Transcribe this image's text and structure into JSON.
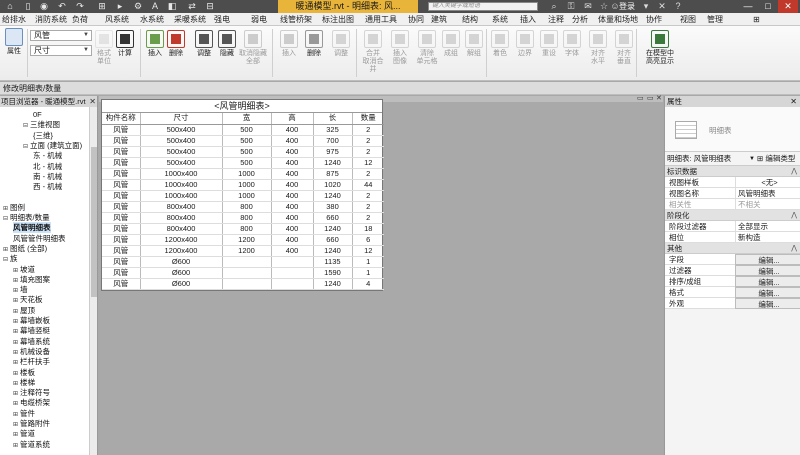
{
  "title": {
    "text": "暖通模型.rvt - 明细表: 风...",
    "search_placeholder": "键入关键字或短语",
    "login": "登录",
    "window_buttons": [
      "—",
      "□",
      "✕"
    ]
  },
  "quick_access": [
    "⌂",
    "▯",
    "◉",
    "↶",
    "↷",
    "⊞",
    "▸",
    "⚙",
    "A",
    "◧",
    "⇄",
    "⊟"
  ],
  "menu": [
    "给排水",
    "消防系统",
    "负荷",
    "风系统",
    "水系统",
    "采暖系统",
    "强电",
    "弱电",
    "线管桥架",
    "标注出图",
    "通用工具",
    "协同",
    "建筑",
    "结构",
    "系统",
    "插入",
    "注释",
    "分析",
    "体量和场地",
    "协作",
    "视图",
    "管理",
    "⊞"
  ],
  "ribbon": {
    "properties_label": "属性",
    "combo_parameter": "风管",
    "combo_unit": "尺寸",
    "buttons": [
      {
        "label": "格式\n单位",
        "icon": "format-units-icon"
      },
      {
        "label": "计算",
        "icon": "calculate-icon"
      },
      {
        "label": "插入",
        "icon": "insert-icon"
      },
      {
        "label": "删除",
        "icon": "delete-icon"
      },
      {
        "label": "调整",
        "icon": "resize-icon"
      },
      {
        "label": "隐藏",
        "icon": "hide-icon"
      },
      {
        "label": "取消隐藏\n全部",
        "icon": "unhide-all-icon"
      },
      {
        "label": "插入",
        "icon": "insert-row-icon"
      },
      {
        "label": "删除",
        "icon": "delete-row-icon"
      },
      {
        "label": "调整",
        "icon": "resize-row-icon"
      },
      {
        "label": "合并\n取消合并",
        "icon": "merge-icon"
      },
      {
        "label": "插入\n图像",
        "icon": "insert-image-icon"
      },
      {
        "label": "清除\n单元格",
        "icon": "clear-cell-icon"
      },
      {
        "label": "成组",
        "icon": "group-icon"
      },
      {
        "label": "解组",
        "icon": "ungroup-icon"
      },
      {
        "label": "着色",
        "icon": "shading-icon"
      },
      {
        "label": "边界",
        "icon": "borders-icon"
      },
      {
        "label": "重设",
        "icon": "reset-icon"
      },
      {
        "label": "字体",
        "icon": "font-icon"
      },
      {
        "label": "对齐\n水平",
        "icon": "align-horizontal-icon"
      },
      {
        "label": "对齐\n垂直",
        "icon": "align-vertical-icon"
      },
      {
        "label": "在模型中\n高亮显示",
        "icon": "highlight-in-model-icon"
      }
    ]
  },
  "context_bar": "修改明细表/数量",
  "browser": {
    "header": "项目浏览器 - 暖通模型.rvt",
    "close": "✕",
    "items": [
      {
        "label": "0F",
        "indent": 3,
        "toggle": ""
      },
      {
        "label": "三维视图",
        "indent": 2,
        "toggle": "⊟"
      },
      {
        "label": "{三维}",
        "indent": 3,
        "toggle": ""
      },
      {
        "label": "立面 (建筑立面)",
        "indent": 2,
        "toggle": "⊟"
      },
      {
        "label": "东 - 机械",
        "indent": 3,
        "toggle": ""
      },
      {
        "label": "北 - 机械",
        "indent": 3,
        "toggle": ""
      },
      {
        "label": "南 - 机械",
        "indent": 3,
        "toggle": ""
      },
      {
        "label": "西 - 机械",
        "indent": 3,
        "toggle": ""
      },
      {
        "label": "",
        "indent": 0,
        "toggle": ""
      },
      {
        "label": "图例",
        "indent": 0,
        "toggle": "⊞"
      },
      {
        "label": "明细表/数量",
        "indent": 0,
        "toggle": "⊟"
      },
      {
        "label": "风管明细表",
        "indent": 1,
        "toggle": "",
        "selected": true
      },
      {
        "label": "风管管件明细表",
        "indent": 1,
        "toggle": ""
      },
      {
        "label": "图纸 (全部)",
        "indent": 0,
        "toggle": "⊞"
      },
      {
        "label": "族",
        "indent": 0,
        "toggle": "⊟"
      },
      {
        "label": "坡道",
        "indent": 1,
        "toggle": "⊞"
      },
      {
        "label": "填充图案",
        "indent": 1,
        "toggle": "⊞"
      },
      {
        "label": "墙",
        "indent": 1,
        "toggle": "⊞"
      },
      {
        "label": "天花板",
        "indent": 1,
        "toggle": "⊞"
      },
      {
        "label": "屋顶",
        "indent": 1,
        "toggle": "⊞"
      },
      {
        "label": "幕墙嵌板",
        "indent": 1,
        "toggle": "⊞"
      },
      {
        "label": "幕墙竖梃",
        "indent": 1,
        "toggle": "⊞"
      },
      {
        "label": "幕墙系统",
        "indent": 1,
        "toggle": "⊞"
      },
      {
        "label": "机械设备",
        "indent": 1,
        "toggle": "⊞"
      },
      {
        "label": "栏杆扶手",
        "indent": 1,
        "toggle": "⊞"
      },
      {
        "label": "楼板",
        "indent": 1,
        "toggle": "⊞"
      },
      {
        "label": "楼梯",
        "indent": 1,
        "toggle": "⊞"
      },
      {
        "label": "注释符号",
        "indent": 1,
        "toggle": "⊞"
      },
      {
        "label": "电缆桥架",
        "indent": 1,
        "toggle": "⊞"
      },
      {
        "label": "管件",
        "indent": 1,
        "toggle": "⊞"
      },
      {
        "label": "管路附件",
        "indent": 1,
        "toggle": "⊞"
      },
      {
        "label": "管道",
        "indent": 1,
        "toggle": "⊞"
      },
      {
        "label": "管道系统",
        "indent": 1,
        "toggle": "⊞"
      }
    ]
  },
  "schedule": {
    "title": "<风管明细表>",
    "columns": [
      "构件名称",
      "尺寸",
      "宽",
      "高",
      "长",
      "数量"
    ],
    "rows": [
      [
        "风管",
        "500x400",
        "500",
        "400",
        "325",
        "2"
      ],
      [
        "风管",
        "500x400",
        "500",
        "400",
        "700",
        "2"
      ],
      [
        "风管",
        "500x400",
        "500",
        "400",
        "975",
        "2"
      ],
      [
        "风管",
        "500x400",
        "500",
        "400",
        "1240",
        "12"
      ],
      [
        "风管",
        "1000x400",
        "1000",
        "400",
        "875",
        "2"
      ],
      [
        "风管",
        "1000x400",
        "1000",
        "400",
        "1020",
        "44"
      ],
      [
        "风管",
        "1000x400",
        "1000",
        "400",
        "1240",
        "2"
      ],
      [
        "风管",
        "800x400",
        "800",
        "400",
        "380",
        "2"
      ],
      [
        "风管",
        "800x400",
        "800",
        "400",
        "660",
        "2"
      ],
      [
        "风管",
        "800x400",
        "800",
        "400",
        "1240",
        "18"
      ],
      [
        "风管",
        "1200x400",
        "1200",
        "400",
        "660",
        "6"
      ],
      [
        "风管",
        "1200x400",
        "1200",
        "400",
        "1240",
        "12"
      ],
      [
        "风管",
        "Ø600",
        "",
        "",
        "1135",
        "1"
      ],
      [
        "风管",
        "Ø600",
        "",
        "",
        "1590",
        "1"
      ],
      [
        "风管",
        "Ø600",
        "",
        "",
        "1240",
        "4"
      ]
    ]
  },
  "properties": {
    "header": "属性",
    "close": "✕",
    "type_name": "明细表",
    "selector": "明细表: 风管明细表",
    "edit_type": "编辑类型",
    "groups": [
      {
        "name": "标识数据",
        "rows": [
          {
            "k": "视图样板",
            "v": "<无>",
            "kind": "center"
          },
          {
            "k": "视图名称",
            "v": "风管明细表",
            "kind": "text"
          },
          {
            "k": "相关性",
            "v": "不相关",
            "kind": "dim"
          }
        ]
      },
      {
        "name": "阶段化",
        "rows": [
          {
            "k": "阶段过滤器",
            "v": "全部显示",
            "kind": "text"
          },
          {
            "k": "相位",
            "v": "新构造",
            "kind": "text"
          }
        ]
      },
      {
        "name": "其他",
        "rows": [
          {
            "k": "字段",
            "v": "编辑...",
            "kind": "btn"
          },
          {
            "k": "过滤器",
            "v": "编辑...",
            "kind": "btn"
          },
          {
            "k": "排序/成组",
            "v": "编辑...",
            "kind": "btn"
          },
          {
            "k": "格式",
            "v": "编辑...",
            "kind": "btn"
          },
          {
            "k": "外观",
            "v": "编辑...",
            "kind": "btn"
          }
        ]
      }
    ]
  },
  "colors": {
    "titlebar": "#4d4d4d",
    "title_highlight": "#e8b43a",
    "selected_row": "#cde3f7"
  }
}
